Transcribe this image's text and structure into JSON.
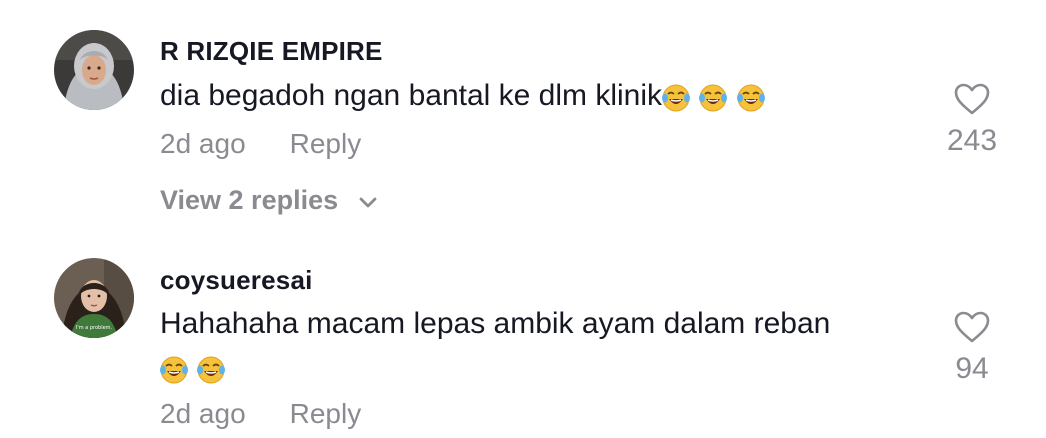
{
  "comments": [
    {
      "username": "R RIZQIE EMPIRE",
      "text": "dia begadoh ngan bantal ke dlm klinik",
      "emojis": [
        "joy-emoji",
        "joy-emoji",
        "joy-emoji"
      ],
      "time": "2d ago",
      "reply_label": "Reply",
      "likes": "243",
      "view_replies": "View 2 replies"
    },
    {
      "username": "coysueresai",
      "text_line1": "Hahahaha macam lepas ambik ayam dalam reban",
      "emojis": [
        "joy-emoji",
        "joy-emoji"
      ],
      "time": "2d ago",
      "reply_label": "Reply",
      "likes": "94",
      "avatar_caption": "I'm a problem."
    }
  ],
  "icons": {
    "like": "heart-outline-icon",
    "expand": "chevron-down-icon",
    "emoji": "face-with-tears-of-joy"
  },
  "colors": {
    "text_primary": "#161823",
    "text_secondary": "#8a8b91",
    "background": "#ffffff"
  }
}
